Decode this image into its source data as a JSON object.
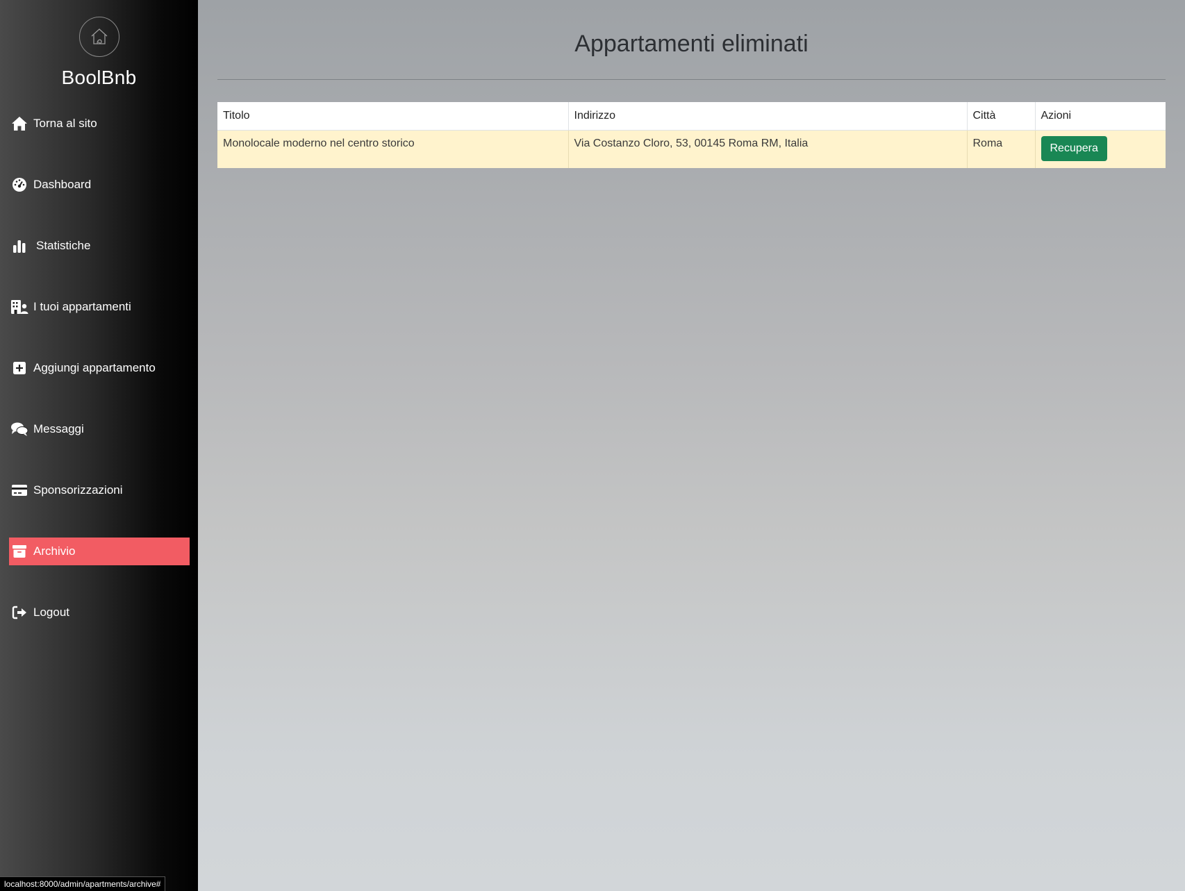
{
  "sidebar": {
    "brand": "BoolBnb",
    "items": [
      {
        "label": "Torna al sito",
        "icon": "home-icon"
      },
      {
        "label": "Dashboard",
        "icon": "gauge-icon"
      },
      {
        "label": "Statistiche",
        "icon": "bar-chart-icon"
      },
      {
        "label": "I tuoi appartamenti",
        "icon": "building-user-icon"
      },
      {
        "label": "Aggiungi appartamento",
        "icon": "plus-square-icon"
      },
      {
        "label": "Messaggi",
        "icon": "comments-icon"
      },
      {
        "label": "Sponsorizzazioni",
        "icon": "credit-card-icon"
      },
      {
        "label": "Archivio",
        "icon": "archive-icon",
        "active": true
      },
      {
        "label": "Logout",
        "icon": "logout-icon"
      }
    ],
    "active_color": "#f25c63"
  },
  "main": {
    "title": "Appartamenti eliminati",
    "table": {
      "headers": [
        "Titolo",
        "Indirizzo",
        "Città",
        "Azioni"
      ],
      "rows": [
        {
          "titolo": "Monolocale moderno nel centro storico",
          "indirizzo": "Via Costanzo Cloro, 53, 00145 Roma RM, Italia",
          "citta": "Roma",
          "action_label": "Recupera"
        }
      ]
    },
    "row_highlight_color": "#fff3cd",
    "action_color": "#198754"
  },
  "status_bar": {
    "url": "localhost:8000/admin/apartments/archive#"
  }
}
